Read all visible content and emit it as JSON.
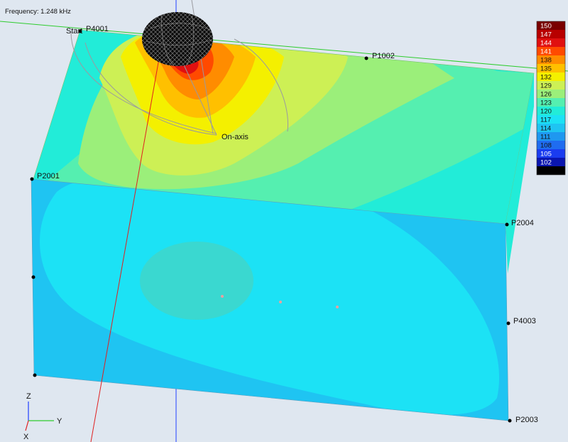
{
  "header": {
    "frequency": "Frequency: 1.248 kHz"
  },
  "points": {
    "start": "Start",
    "p4001": "P4001",
    "p1002": "P1002",
    "p2001": "P2001",
    "p2004": "P2004",
    "p4003": "P4003",
    "p2003": "P2003",
    "on_axis": "On-axis"
  },
  "axes": {
    "z": "Z",
    "y": "Y",
    "x": "X"
  },
  "legend": {
    "entries": [
      {
        "value": "150",
        "color": "#7a0000"
      },
      {
        "value": "147",
        "color": "#b80000"
      },
      {
        "value": "144",
        "color": "#e01010"
      },
      {
        "value": "141",
        "color": "#ff4a00"
      },
      {
        "value": "138",
        "color": "#ff8c00"
      },
      {
        "value": "135",
        "color": "#ffc000"
      },
      {
        "value": "132",
        "color": "#f4f000"
      },
      {
        "value": "129",
        "color": "#cdf055"
      },
      {
        "value": "126",
        "color": "#9bef7a"
      },
      {
        "value": "123",
        "color": "#55efb0"
      },
      {
        "value": "120",
        "color": "#22ecd8"
      },
      {
        "value": "117",
        "color": "#1ce2f5"
      },
      {
        "value": "114",
        "color": "#1fc4f2"
      },
      {
        "value": "111",
        "color": "#1f98f0"
      },
      {
        "value": "108",
        "color": "#1f6cf0"
      },
      {
        "value": "105",
        "color": "#1a3cf0"
      },
      {
        "value": "102",
        "color": "#0a16b0"
      },
      {
        "value": "",
        "color": "#000000"
      }
    ]
  },
  "colors": {
    "background": "#dfe7f0",
    "line_green": "#2ecc2e",
    "line_red": "#e02020",
    "line_blue": "#2040ff"
  }
}
